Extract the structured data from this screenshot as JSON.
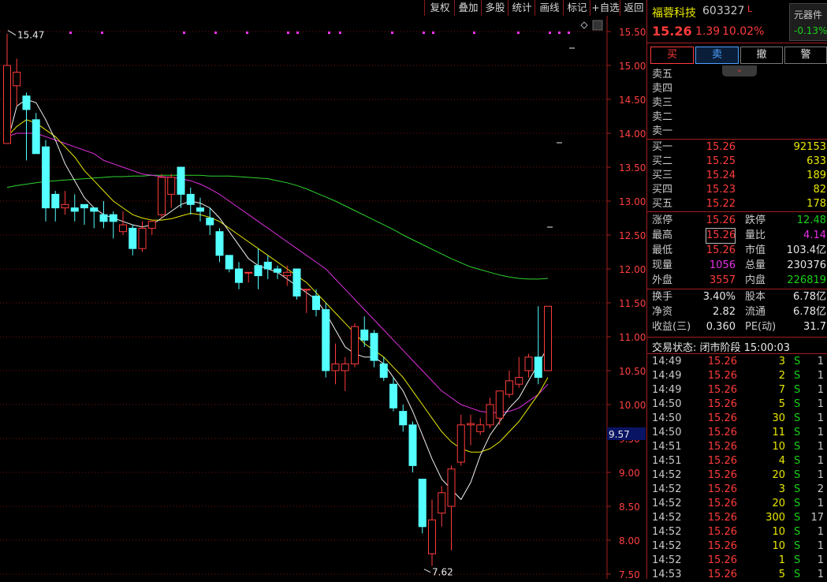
{
  "toolbar": {
    "items": [
      "复权",
      "叠加",
      "多股",
      "统计",
      "画线",
      "标记",
      "+自选",
      "返回"
    ]
  },
  "chart_data": {
    "type": "candlestick",
    "y_axis_ticks": [
      "15.50",
      "15.00",
      "14.50",
      "14.00",
      "13.50",
      "13.00",
      "12.50",
      "12.00",
      "11.50",
      "11.00",
      "10.50",
      "10.00",
      "9.50",
      "9.00",
      "8.50",
      "8.00",
      "7.50"
    ],
    "ylim": [
      7.5,
      15.65
    ],
    "high_label": "15.47",
    "low_label": "7.62",
    "cursor_price": "9.57",
    "candles": [
      [
        13.85,
        15.0,
        15.47,
        13.85
      ],
      [
        14.7,
        14.9,
        15.1,
        14.4
      ],
      [
        14.55,
        14.35,
        14.6,
        13.6
      ],
      [
        14.2,
        13.7,
        14.3,
        13.7
      ],
      [
        13.8,
        12.9,
        13.9,
        12.7
      ],
      [
        13.1,
        12.9,
        13.15,
        12.7
      ],
      [
        12.9,
        12.95,
        13.15,
        12.8
      ],
      [
        12.9,
        12.85,
        13.1,
        12.7
      ],
      [
        12.95,
        12.9,
        12.95,
        12.65
      ],
      [
        12.9,
        12.85,
        12.9,
        12.6
      ],
      [
        12.8,
        12.7,
        13.0,
        12.6
      ],
      [
        12.8,
        12.7,
        12.85,
        12.45
      ],
      [
        12.55,
        12.65,
        12.85,
        12.5
      ],
      [
        12.6,
        12.3,
        12.65,
        12.2
      ],
      [
        12.3,
        12.6,
        12.7,
        12.25
      ],
      [
        12.6,
        12.7,
        12.7,
        12.5
      ],
      [
        12.8,
        13.35,
        13.4,
        12.75
      ],
      [
        13.1,
        13.35,
        13.4,
        12.9
      ],
      [
        13.5,
        13.1,
        13.5,
        12.9
      ],
      [
        13.1,
        12.95,
        13.2,
        12.8
      ],
      [
        12.9,
        12.85,
        13.05,
        12.7
      ],
      [
        12.75,
        12.65,
        12.9,
        12.5
      ],
      [
        12.55,
        12.2,
        12.6,
        12.1
      ],
      [
        12.2,
        12.0,
        12.2,
        11.95
      ],
      [
        12.0,
        11.8,
        12.1,
        11.7
      ],
      [
        11.95,
        11.95,
        11.95,
        11.8
      ],
      [
        12.05,
        11.9,
        12.3,
        11.7
      ],
      [
        12.1,
        12.0,
        12.2,
        11.85
      ],
      [
        12.0,
        11.95,
        12.05,
        11.85
      ],
      [
        11.9,
        11.95,
        12.05,
        11.75
      ],
      [
        12.0,
        11.6,
        12.0,
        11.55
      ],
      [
        11.7,
        11.7,
        11.7,
        11.35
      ],
      [
        11.6,
        11.4,
        11.7,
        11.3
      ],
      [
        11.4,
        10.5,
        11.5,
        10.4
      ],
      [
        10.5,
        10.6,
        10.9,
        10.3
      ],
      [
        10.5,
        10.6,
        10.7,
        10.2
      ],
      [
        10.6,
        11.15,
        11.2,
        10.55
      ],
      [
        11.1,
        10.95,
        11.3,
        10.85
      ],
      [
        11.05,
        10.65,
        11.1,
        10.55
      ],
      [
        10.6,
        10.4,
        10.7,
        10.35
      ],
      [
        10.3,
        9.95,
        10.4,
        9.9
      ],
      [
        9.9,
        9.7,
        10.0,
        9.6
      ],
      [
        9.7,
        9.1,
        9.75,
        9.0
      ],
      [
        8.9,
        8.2,
        8.9,
        8.1
      ],
      [
        7.8,
        8.3,
        8.6,
        7.62
      ],
      [
        8.4,
        8.7,
        8.8,
        8.2
      ],
      [
        8.5,
        9.05,
        9.1,
        7.85
      ],
      [
        9.15,
        9.7,
        9.85,
        9.1
      ],
      [
        9.7,
        9.72,
        9.85,
        9.4
      ],
      [
        9.6,
        9.7,
        9.8,
        9.55
      ],
      [
        9.7,
        10.0,
        10.1,
        9.65
      ],
      [
        9.8,
        10.2,
        10.2,
        9.7
      ],
      [
        10.15,
        10.35,
        10.5,
        10.1
      ],
      [
        10.3,
        10.4,
        10.7,
        10.25
      ],
      [
        10.5,
        10.7,
        10.75,
        10.4
      ],
      [
        10.7,
        10.4,
        11.45,
        10.3
      ],
      [
        10.5,
        11.45,
        11.45,
        10.5
      ]
    ],
    "ma5": [
      13.85,
      14.4,
      14.5,
      14.45,
      14.2,
      13.9,
      13.55,
      13.3,
      13.05,
      12.9,
      12.8,
      12.75,
      12.7,
      12.65,
      12.62,
      12.65,
      12.75,
      12.85,
      12.95,
      13.0,
      12.97,
      12.9,
      12.75,
      12.55,
      12.35,
      12.15,
      12.05,
      12.0,
      11.95,
      11.85,
      11.75,
      11.65,
      11.55,
      11.35,
      11.1,
      10.85,
      10.75,
      10.7,
      10.7,
      10.6,
      10.4,
      10.2,
      9.9,
      9.55,
      9.2,
      8.9,
      8.75,
      8.6,
      8.85,
      9.25,
      9.55,
      9.75,
      9.95,
      10.1,
      10.35,
      10.6,
      10.85
    ],
    "ma10": [
      13.95,
      14.1,
      14.2,
      14.15,
      14.05,
      13.95,
      13.8,
      13.65,
      13.45,
      13.3,
      13.15,
      13.0,
      12.9,
      12.8,
      12.75,
      12.72,
      12.72,
      12.74,
      12.78,
      12.82,
      12.8,
      12.76,
      12.7,
      12.6,
      12.5,
      12.4,
      12.3,
      12.2,
      12.1,
      12.0,
      11.9,
      11.8,
      11.65,
      11.5,
      11.35,
      11.2,
      11.05,
      10.9,
      10.8,
      10.7,
      10.55,
      10.4,
      10.2,
      10.0,
      9.8,
      9.6,
      9.45,
      9.35,
      9.3,
      9.3,
      9.35,
      9.45,
      9.6,
      9.75,
      9.95,
      10.15,
      10.4
    ],
    "ma20": [
      13.95,
      14.0,
      14.0,
      14.0,
      13.95,
      13.9,
      13.85,
      13.8,
      13.75,
      13.7,
      13.6,
      13.55,
      13.5,
      13.45,
      13.4,
      13.38,
      13.36,
      13.35,
      13.33,
      13.3,
      13.25,
      13.18,
      13.1,
      13.0,
      12.9,
      12.8,
      12.7,
      12.6,
      12.5,
      12.4,
      12.3,
      12.2,
      12.1,
      12.0,
      11.85,
      11.7,
      11.55,
      11.4,
      11.25,
      11.1,
      10.95,
      10.8,
      10.65,
      10.5,
      10.35,
      10.2,
      10.1,
      10.0,
      9.95,
      9.9,
      9.88,
      9.88,
      9.9,
      9.95,
      10.05,
      10.15,
      10.3
    ],
    "ma60": [
      13.2,
      13.23,
      13.25,
      13.27,
      13.29,
      13.3,
      13.31,
      13.32,
      13.33,
      13.34,
      13.35,
      13.36,
      13.36,
      13.37,
      13.37,
      13.38,
      13.38,
      13.38,
      13.38,
      13.38,
      13.38,
      13.37,
      13.37,
      13.37,
      13.36,
      13.35,
      13.34,
      13.33,
      13.3,
      13.27,
      13.23,
      13.18,
      13.12,
      13.06,
      13.0,
      12.93,
      12.86,
      12.79,
      12.72,
      12.65,
      12.58,
      12.5,
      12.43,
      12.36,
      12.29,
      12.22,
      12.15,
      12.09,
      12.03,
      11.99,
      11.95,
      11.91,
      11.88,
      11.86,
      11.85,
      11.85,
      11.86
    ]
  },
  "quote": {
    "name": "福蓉科技",
    "code": "603327",
    "flag": "L",
    "price": "15.26",
    "change": "1.39",
    "pct": "10.02%",
    "sector_label": "元器件",
    "sector_pct": "-0.13%"
  },
  "buttons": {
    "buy": "买",
    "sell": "卖",
    "cancel": "撤",
    "alert": "警"
  },
  "sells": [
    "卖五",
    "卖四",
    "卖三",
    "卖二",
    "卖一"
  ],
  "buys": [
    {
      "label": "买一",
      "price": "15.26",
      "vol": "92153"
    },
    {
      "label": "买二",
      "price": "15.25",
      "vol": "633"
    },
    {
      "label": "买三",
      "price": "15.24",
      "vol": "189"
    },
    {
      "label": "买四",
      "price": "15.23",
      "vol": "82"
    },
    {
      "label": "买五",
      "price": "15.22",
      "vol": "178"
    }
  ],
  "stats": {
    "zt_label": "涨停",
    "zt": "15.26",
    "dt_label": "跌停",
    "dt": "12.48",
    "high_label": "最高",
    "high": "15.26",
    "lb_label": "量比",
    "lb": "4.14",
    "low_label": "最低",
    "low": "15.26",
    "sz_label": "市值",
    "sz": "103.4亿",
    "xl_label": "现量",
    "xl": "1056",
    "zl_label": "总量",
    "zl": "230376",
    "wp_label": "外盘",
    "wp": "3557",
    "np_label": "内盘",
    "np": "226819"
  },
  "fund": {
    "hs_label": "换手",
    "hs": "3.40%",
    "gb_label": "股本",
    "gb": "6.78亿",
    "jz_label": "净资",
    "jz": "2.82",
    "lt_label": "流通",
    "lt": "6.78亿",
    "sy_label": "收益(三)",
    "sy": "0.360",
    "pe_label": "PE(动)",
    "pe": "31.7"
  },
  "status": "交易状态: 闭市阶段 15:00:03",
  "ticks": [
    {
      "t": "14:49",
      "p": "15.26",
      "v": "3",
      "d": "S",
      "n": "1"
    },
    {
      "t": "14:49",
      "p": "15.26",
      "v": "2",
      "d": "S",
      "n": "1"
    },
    {
      "t": "14:49",
      "p": "15.26",
      "v": "7",
      "d": "S",
      "n": "1"
    },
    {
      "t": "14:50",
      "p": "15.26",
      "v": "5",
      "d": "S",
      "n": "1"
    },
    {
      "t": "14:50",
      "p": "15.26",
      "v": "30",
      "d": "S",
      "n": "1"
    },
    {
      "t": "14:50",
      "p": "15.26",
      "v": "11",
      "d": "S",
      "n": "1"
    },
    {
      "t": "14:51",
      "p": "15.26",
      "v": "10",
      "d": "S",
      "n": "1"
    },
    {
      "t": "14:51",
      "p": "15.26",
      "v": "4",
      "d": "S",
      "n": "1"
    },
    {
      "t": "14:52",
      "p": "15.26",
      "v": "20",
      "d": "S",
      "n": "1"
    },
    {
      "t": "14:52",
      "p": "15.26",
      "v": "3",
      "d": "S",
      "n": "2"
    },
    {
      "t": "14:52",
      "p": "15.26",
      "v": "20",
      "d": "S",
      "n": "1"
    },
    {
      "t": "14:52",
      "p": "15.26",
      "v": "300",
      "d": "S",
      "n": "17"
    },
    {
      "t": "14:52",
      "p": "15.26",
      "v": "10",
      "d": "S",
      "n": "1"
    },
    {
      "t": "14:52",
      "p": "15.26",
      "v": "10",
      "d": "S",
      "n": "1"
    },
    {
      "t": "14:52",
      "p": "15.26",
      "v": "1",
      "d": "S",
      "n": "1"
    },
    {
      "t": "14:53",
      "p": "15.26",
      "v": "5",
      "d": "S",
      "n": "1"
    }
  ]
}
